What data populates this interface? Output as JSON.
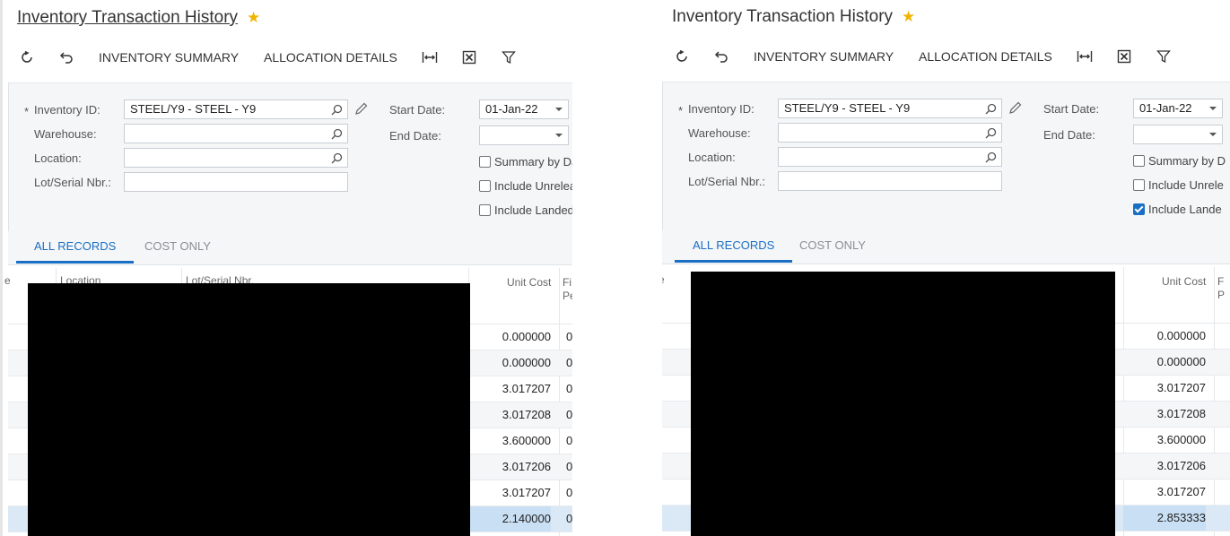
{
  "title": "Inventory Transaction History",
  "toolbar": {
    "summary_label": "INVENTORY SUMMARY",
    "allocation_label": "ALLOCATION DETAILS"
  },
  "form": {
    "inventory_id_label": "Inventory ID:",
    "required_mark": "*",
    "warehouse_label": "Warehouse:",
    "location_label": "Location:",
    "lot_label": "Lot/Serial Nbr.:",
    "start_date_label": "Start Date:",
    "end_date_label": "End Date:",
    "inventory_id_value": "STEEL/Y9 - STEEL - Y9",
    "start_date_value": "01-Jan-22"
  },
  "left_panel": {
    "checkboxes": [
      "Summary by Da",
      "Include Unrelea",
      "Include Landed"
    ],
    "checked": [
      false,
      false,
      false
    ],
    "headers": {
      "location": "Location",
      "lot": "Lot/Serial Nbr.",
      "unit_cost": "Unit Cost",
      "fi": "Fi",
      "fi2": "Pe",
      "left_stub": "e"
    },
    "unit_costs": [
      "0.000000",
      "0.000000",
      "3.017207",
      "3.017208",
      "3.600000",
      "3.017206",
      "3.017207",
      "2.140000"
    ],
    "fi_values": [
      "0",
      "0",
      "0",
      "0",
      "0",
      "0",
      "0",
      "0"
    ]
  },
  "right_panel": {
    "checkboxes": [
      "Summary by D",
      "Include Unrele",
      "Include Lande"
    ],
    "checked": [
      false,
      false,
      true
    ],
    "headers": {
      "unit_cost": "Unit Cost",
      "fi": "F",
      "fi2": "P",
      "left_stub": "e"
    },
    "unit_costs": [
      "0.000000",
      "0.000000",
      "3.017207",
      "3.017208",
      "3.600000",
      "3.017206",
      "3.017207",
      "2.853333"
    ]
  },
  "tabs": [
    "ALL RECORDS",
    "COST ONLY"
  ],
  "colors": {
    "accent": "#1a6fc4",
    "star": "#f0b400",
    "selected_row": "#dbe9f7"
  },
  "icons": [
    "refresh-icon",
    "undo-icon",
    "fit-columns-icon",
    "export-excel-icon",
    "filter-icon",
    "search-icon",
    "edit-icon",
    "star-icon"
  ]
}
